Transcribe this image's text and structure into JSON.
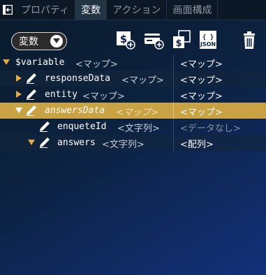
{
  "tabs": [
    {
      "label": "プロパティ",
      "active": false
    },
    {
      "label": "変数",
      "active": true
    },
    {
      "label": "アクション",
      "active": false
    },
    {
      "label": "画面構成",
      "active": false
    }
  ],
  "toolbar": {
    "variable_select": {
      "selected": "変数"
    },
    "json_icon_text": "JSON",
    "json_braces": "{ }",
    "dollar": "$"
  },
  "tree": {
    "rows": [
      {
        "name": "$variable",
        "type": "<マップ>",
        "value": "<マップ>",
        "expanded": true,
        "depth": 0
      },
      {
        "name": "responseData",
        "type": "<マップ>",
        "value": "<マップ>",
        "expanded": false,
        "depth": 1
      },
      {
        "name": "entity",
        "type": "<マップ>",
        "value": "<マップ>",
        "expanded": false,
        "depth": 1
      },
      {
        "name": "answersData",
        "type": "<マップ>",
        "value": "<マップ>",
        "expanded": true,
        "depth": 1,
        "selected": true
      },
      {
        "name": "enqueteId",
        "type": "<文字列>",
        "value": "<データなし>",
        "depth": 2,
        "empty": true
      },
      {
        "name": "answers",
        "type": "<文字列>",
        "value": "<配列>",
        "expanded": true,
        "depth": 2
      }
    ]
  },
  "colors": {
    "accent": "#e2a948",
    "selected_row": "#c9a243",
    "tab_active": "#233445"
  }
}
